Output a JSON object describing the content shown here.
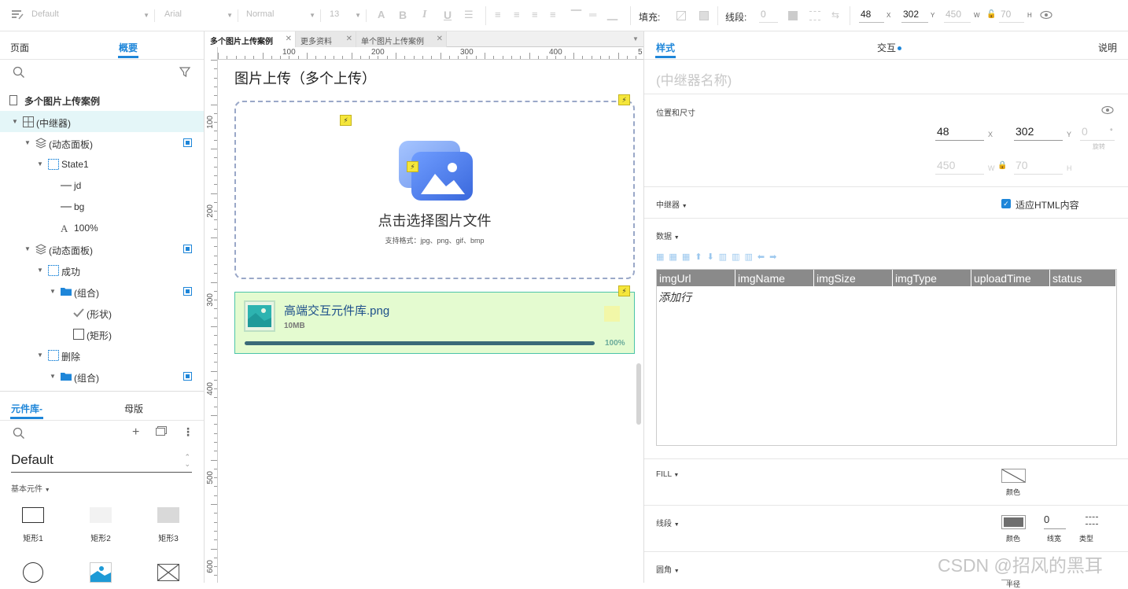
{
  "toolbar": {
    "style_select": "Default",
    "font_select": "Arial",
    "weight_select": "Normal",
    "size_select": "13",
    "fill_label": "填充:",
    "line_label": "线段:",
    "line_width": "0",
    "x_value": "48",
    "x_suffix": "X",
    "y_value": "302",
    "y_suffix": "Y",
    "w_value": "450",
    "w_suffix": "W",
    "h_value": "70",
    "h_suffix": "H"
  },
  "left": {
    "tab_pages": "页面",
    "tab_outline": "概要",
    "page_title": "多个图片上传案例",
    "tree": [
      {
        "label": "(中继器)",
        "indent": 0,
        "icon": "repeater-icon",
        "selected": true,
        "checkbox": false
      },
      {
        "label": "(动态面板)",
        "indent": 1,
        "icon": "layers-icon",
        "selected": false,
        "checkbox": true
      },
      {
        "label": "State1",
        "indent": 2,
        "icon": "state-icon",
        "selected": false,
        "checkbox": false
      },
      {
        "label": "jd",
        "indent": 3,
        "icon": "line-icon",
        "selected": false,
        "checkbox": false
      },
      {
        "label": "bg",
        "indent": 3,
        "icon": "line-icon",
        "selected": false,
        "checkbox": false
      },
      {
        "label": "100%",
        "indent": 3,
        "icon": "text-icon",
        "selected": false,
        "checkbox": false
      },
      {
        "label": "(动态面板)",
        "indent": 1,
        "icon": "layers-icon",
        "selected": false,
        "checkbox": true
      },
      {
        "label": "成功",
        "indent": 2,
        "icon": "state-icon",
        "selected": false,
        "checkbox": false
      },
      {
        "label": "(组合)",
        "indent": 3,
        "icon": "folder-icon",
        "selected": false,
        "checkbox": true
      },
      {
        "label": "(形状)",
        "indent": 4,
        "icon": "check-shape-icon",
        "selected": false,
        "checkbox": false
      },
      {
        "label": "(矩形)",
        "indent": 4,
        "icon": "rectangle-icon",
        "selected": false,
        "checkbox": false
      },
      {
        "label": "删除",
        "indent": 2,
        "icon": "state-icon",
        "selected": false,
        "checkbox": false
      },
      {
        "label": "(组合)",
        "indent": 3,
        "icon": "folder-icon",
        "selected": false,
        "checkbox": true
      }
    ],
    "lib_tab": "元件库-",
    "master_tab": "母版",
    "lib_select": "Default",
    "basic_section": "基本元件",
    "widgets": [
      "矩形1",
      "矩形2",
      "矩形3"
    ]
  },
  "canvas": {
    "tabs": [
      "多个图片上传案例",
      "更多资料",
      "单个图片上传案例"
    ],
    "hruler": [
      "100",
      "200",
      "300",
      "400",
      "5"
    ],
    "vruler": [
      "100",
      "200",
      "300",
      "400",
      "500",
      "600"
    ],
    "heading": "图片上传（多个上传）",
    "upload_title": "点击选择图片文件",
    "upload_formats": "支持格式：jpg、png、gif、bmp",
    "file_name": "高端交互元件库.png",
    "file_size": "10MB",
    "progress_label": "100%",
    "progress": 1.0
  },
  "right": {
    "tab_style": "样式",
    "tab_interact": "交互",
    "tab_notes": "说明",
    "name_placeholder": "(中继器名称)",
    "pos_section": "位置和尺寸",
    "x": "48",
    "x_suffix": "X",
    "y": "302",
    "y_suffix": "Y",
    "rot": "0",
    "rot_suffix": "°",
    "rot_label": "旋转",
    "w": "450",
    "w_suffix": "W",
    "h": "70",
    "h_suffix": "H",
    "repeater_section": "中继器",
    "fit_html": "适应HTML内容",
    "data_section": "数据",
    "columns": [
      "imgUrl",
      "imgName",
      "imgSize",
      "imgType",
      "uploadTime",
      "status"
    ],
    "add_row": "添加行",
    "fill_section": "FILL",
    "fill_color_label": "颜色",
    "line_section": "线段",
    "line_color_label": "颜色",
    "line_width": "0",
    "line_width_label": "线宽",
    "line_type_label": "类型",
    "corner_section": "圆角",
    "corner_radius_label": "半径"
  },
  "watermark": "CSDN @招风的黑耳",
  "colors": {
    "accent": "#1e86d9",
    "selected_row": "#e4f6f8",
    "progress": "#3a6a78",
    "file_bg": "#e4fbd0",
    "header_gray": "#8a8a8a"
  }
}
